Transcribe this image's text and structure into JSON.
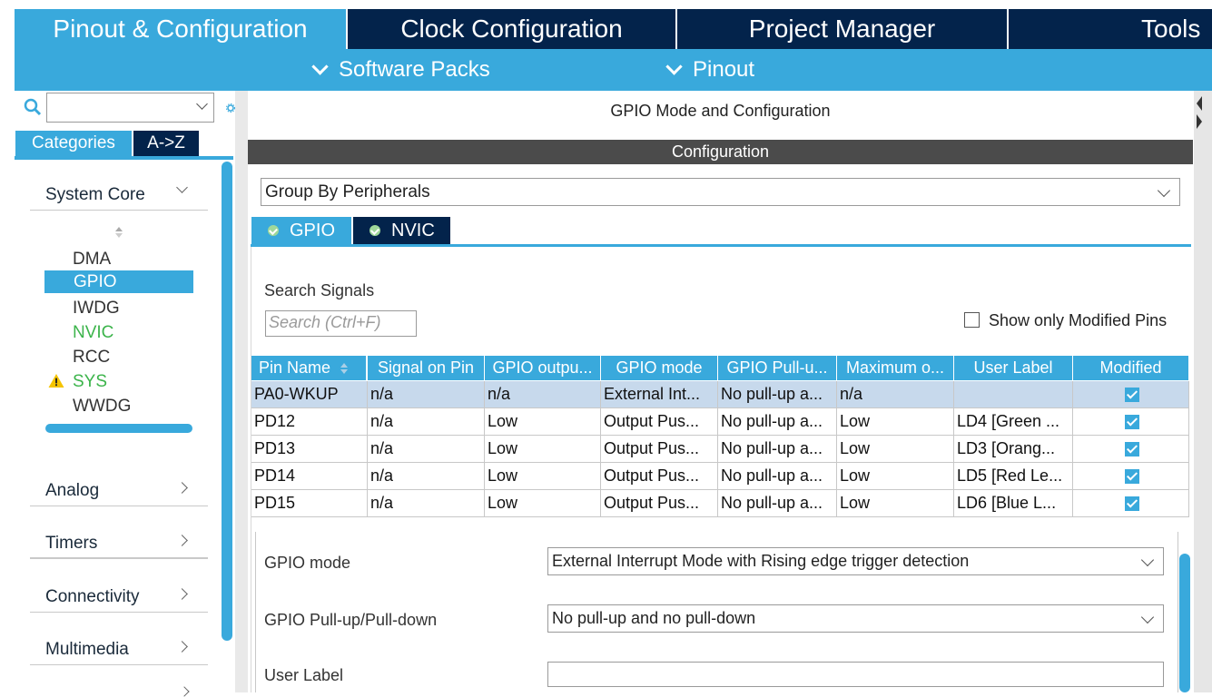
{
  "top_tabs": [
    {
      "label": "Pinout & Configuration",
      "active": true
    },
    {
      "label": "Clock Configuration",
      "active": false
    },
    {
      "label": "Project Manager",
      "active": false
    },
    {
      "label": "Tools",
      "active": false
    }
  ],
  "sub_menu": {
    "software_packs": "Software Packs",
    "pinout": "Pinout"
  },
  "left_panel": {
    "search_value": "",
    "category_tabs": {
      "categories": "Categories",
      "az": "A->Z"
    },
    "sections": {
      "system_core": "System Core",
      "analog": "Analog",
      "timers": "Timers",
      "connectivity": "Connectivity",
      "multimedia": "Multimedia"
    },
    "peripherals": [
      {
        "name": "DMA",
        "status": "normal"
      },
      {
        "name": "GPIO",
        "status": "selected"
      },
      {
        "name": "IWDG",
        "status": "normal"
      },
      {
        "name": "NVIC",
        "status": "configured"
      },
      {
        "name": "RCC",
        "status": "normal"
      },
      {
        "name": "SYS",
        "status": "warning"
      },
      {
        "name": "WWDG",
        "status": "normal"
      }
    ]
  },
  "main": {
    "mode_header": "GPIO Mode and Configuration",
    "config_header": "Configuration",
    "group_select": "Group By Peripherals",
    "peripheral_tabs": {
      "gpio": "GPIO",
      "nvic": "NVIC"
    },
    "search_label": "Search Signals",
    "search_placeholder": "Search (Ctrl+F)",
    "show_modified_label": "Show only Modified Pins",
    "show_modified_checked": false,
    "table": {
      "columns": [
        "Pin Name",
        "Signal on Pin",
        "GPIO outpu...",
        "GPIO mode",
        "GPIO Pull-u...",
        "Maximum o...",
        "User Label",
        "Modified"
      ],
      "rows": [
        {
          "pin": "PA0-WKUP",
          "signal": "n/a",
          "output": "n/a",
          "mode": "External Int...",
          "pull": "No pull-up a...",
          "speed": "n/a",
          "label": "",
          "modified": true
        },
        {
          "pin": "PD12",
          "signal": "n/a",
          "output": "Low",
          "mode": "Output Pus...",
          "pull": "No pull-up a...",
          "speed": "Low",
          "label": "LD4 [Green ...",
          "modified": true
        },
        {
          "pin": "PD13",
          "signal": "n/a",
          "output": "Low",
          "mode": "Output Pus...",
          "pull": "No pull-up a...",
          "speed": "Low",
          "label": "LD3 [Orang...",
          "modified": true
        },
        {
          "pin": "PD14",
          "signal": "n/a",
          "output": "Low",
          "mode": "Output Pus...",
          "pull": "No pull-up a...",
          "speed": "Low",
          "label": "LD5 [Red Le...",
          "modified": true
        },
        {
          "pin": "PD15",
          "signal": "n/a",
          "output": "Low",
          "mode": "Output Pus...",
          "pull": "No pull-up a...",
          "speed": "Low",
          "label": "LD6 [Blue L...",
          "modified": true
        }
      ]
    },
    "detail": {
      "gpio_mode_label": "GPIO mode",
      "gpio_mode_value": "External Interrupt Mode with Rising edge trigger detection",
      "pull_label": "GPIO Pull-up/Pull-down",
      "pull_value": "No pull-up and no pull-down",
      "user_label_label": "User Label",
      "user_label_value": ""
    }
  },
  "colors": {
    "accent": "#39a9dc",
    "dark_tab": "#03234b",
    "config_header": "#4b4b4b",
    "ok_green": "#3cb44b",
    "warning": "#f5c400"
  }
}
